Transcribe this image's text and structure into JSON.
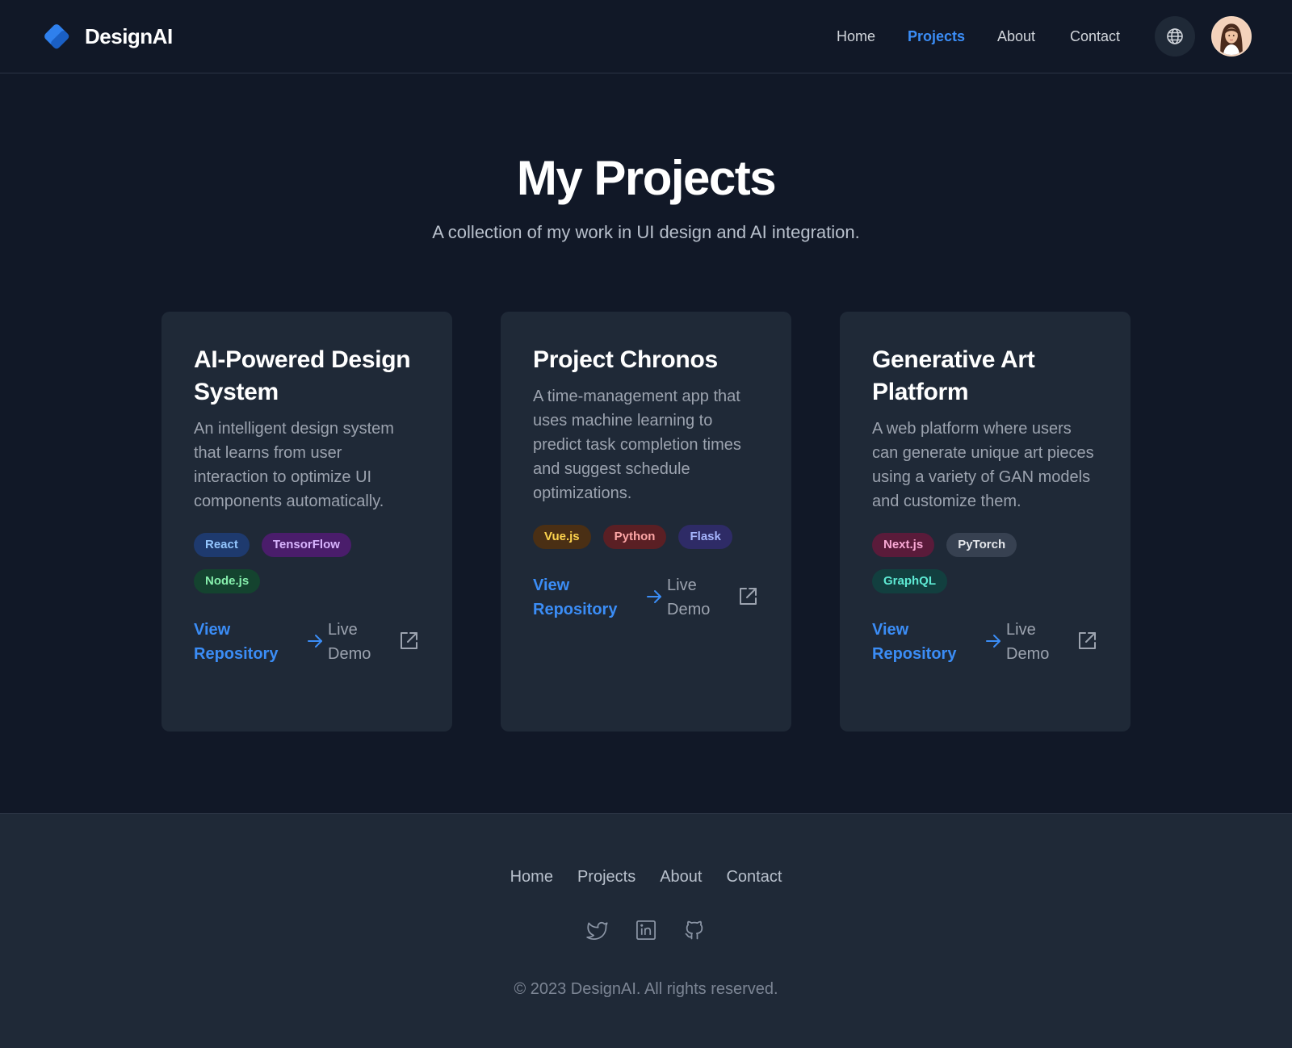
{
  "header": {
    "brand": "DesignAI",
    "nav": [
      {
        "label": "Home",
        "active": false
      },
      {
        "label": "Projects",
        "active": true
      },
      {
        "label": "About",
        "active": false
      },
      {
        "label": "Contact",
        "active": false
      }
    ],
    "icons": {
      "logo": "diamond-logo-icon",
      "globe": "globe-icon",
      "avatar": "user-avatar"
    }
  },
  "hero": {
    "title": "My Projects",
    "subtitle": "A collection of my work in UI design and AI integration."
  },
  "projects": [
    {
      "title": "AI-Powered Design System",
      "description": "An intelligent design system that learns from user interaction to optimize UI components automatically.",
      "tags": [
        {
          "label": "React",
          "bg": "#1e3a6e",
          "fg": "#93c5fd"
        },
        {
          "label": "TensorFlow",
          "bg": "#4a1d6b",
          "fg": "#d8b4fe"
        },
        {
          "label": "Node.js",
          "bg": "#14432f",
          "fg": "#86efac"
        }
      ],
      "repo_label": "View Repository",
      "demo_label": "Live Demo"
    },
    {
      "title": "Project Chronos",
      "description": "A time-management app that uses machine learning to predict task completion times and suggest schedule optimizations.",
      "tags": [
        {
          "label": "Vue.js",
          "bg": "#4a2f14",
          "fg": "#fcd34d"
        },
        {
          "label": "Python",
          "bg": "#5a1f24",
          "fg": "#fca5a5"
        },
        {
          "label": "Flask",
          "bg": "#2e2b66",
          "fg": "#a5b4fc"
        }
      ],
      "repo_label": "View Repository",
      "demo_label": "Live Demo"
    },
    {
      "title": "Generative Art Platform",
      "description": "A web platform where users can generate unique art pieces using a variety of GAN models and customize them.",
      "tags": [
        {
          "label": "Next.js",
          "bg": "#5a1b3a",
          "fg": "#f9a8d4"
        },
        {
          "label": "PyTorch",
          "bg": "#374151",
          "fg": "#e5e7eb"
        },
        {
          "label": "GraphQL",
          "bg": "#123f3f",
          "fg": "#5eead4"
        }
      ],
      "repo_label": "View Repository",
      "demo_label": "Live Demo"
    }
  ],
  "footer": {
    "links": [
      "Home",
      "Projects",
      "About",
      "Contact"
    ],
    "social": [
      "twitter-icon",
      "linkedin-icon",
      "github-icon"
    ],
    "copyright": "© 2023 DesignAI. All rights reserved."
  },
  "colors": {
    "background": "#111827",
    "card": "#1f2937",
    "accent": "#3b8df6"
  }
}
